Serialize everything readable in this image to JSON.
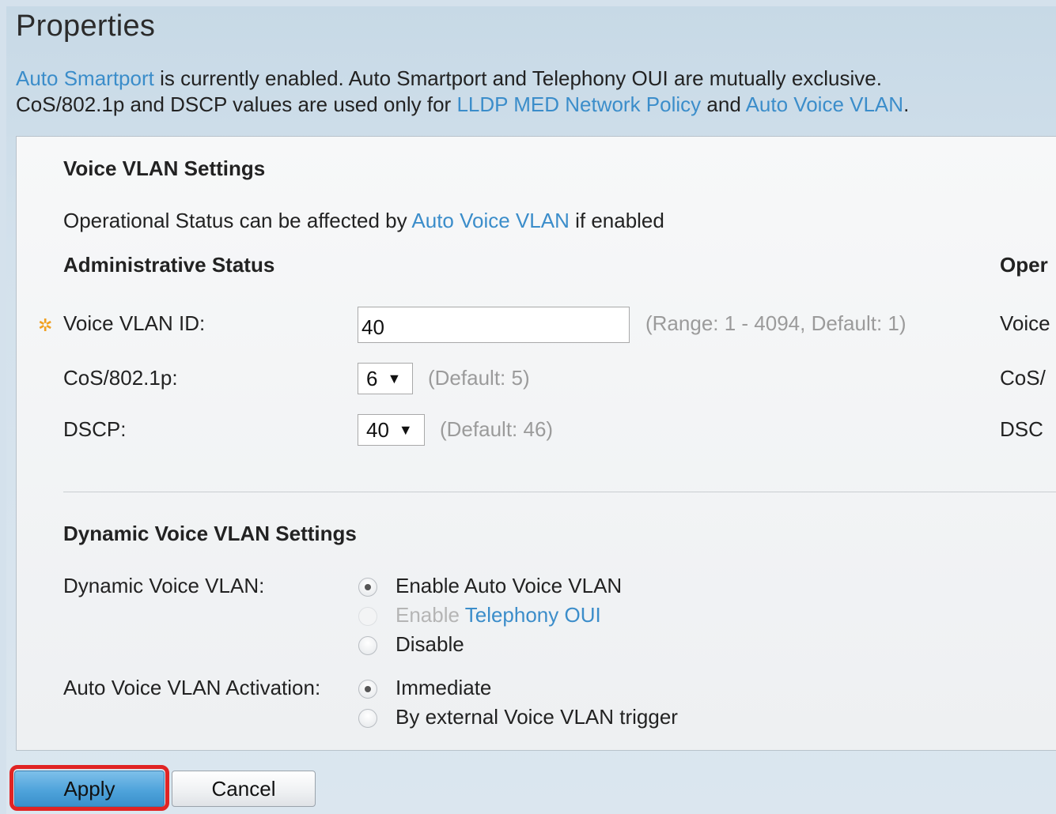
{
  "page": {
    "title": "Properties"
  },
  "info": {
    "line1": {
      "link": "Auto Smartport",
      "text": "is currently enabled. Auto Smartport and Telephony OUI are mutually exclusive."
    },
    "line2": {
      "prefix": "CoS/802.1p and DSCP values are used only for",
      "link1": "LLDP MED Network Policy",
      "middle": "and",
      "link2": "Auto Voice VLAN",
      "suffix": "."
    }
  },
  "voice_vlan": {
    "section_title": "Voice VLAN Settings",
    "op_note_prefix": "Operational Status can be affected by",
    "op_note_link": "Auto Voice VLAN",
    "op_note_suffix": "if enabled",
    "admin_heading": "Administrative Status",
    "oper_heading_clip": "Oper",
    "vlan_id": {
      "label": "Voice VLAN ID:",
      "value": "40",
      "hint": "(Range: 1 - 4094, Default: 1)",
      "oper_clip": "Voice"
    },
    "cos": {
      "label": "CoS/802.1p:",
      "value": "6",
      "hint": "(Default: 5)",
      "oper_clip": "CoS/"
    },
    "dscp": {
      "label": "DSCP:",
      "value": "40",
      "hint": "(Default: 46)",
      "oper_clip": "DSC"
    }
  },
  "dynamic": {
    "section_title": "Dynamic Voice VLAN Settings",
    "dynamic_label": "Dynamic Voice VLAN:",
    "options": {
      "enable_auto": "Enable Auto Voice VLAN",
      "enable_tel_prefix": "Enable",
      "enable_tel_link": "Telephony OUI",
      "disable": "Disable"
    },
    "selected": "enable_auto",
    "activation_label": "Auto Voice VLAN Activation:",
    "activation_options": {
      "immediate": "Immediate",
      "external": "By external Voice VLAN trigger"
    },
    "activation_selected": "immediate"
  },
  "buttons": {
    "apply": "Apply",
    "cancel": "Cancel"
  },
  "colors": {
    "link": "#3b8dca",
    "apply": "#4fa3db",
    "highlight": "#e02424",
    "required_icon": "#f0a020"
  },
  "icons": {
    "required": "gear-star-icon",
    "dropdown": "triangle-down-icon"
  }
}
